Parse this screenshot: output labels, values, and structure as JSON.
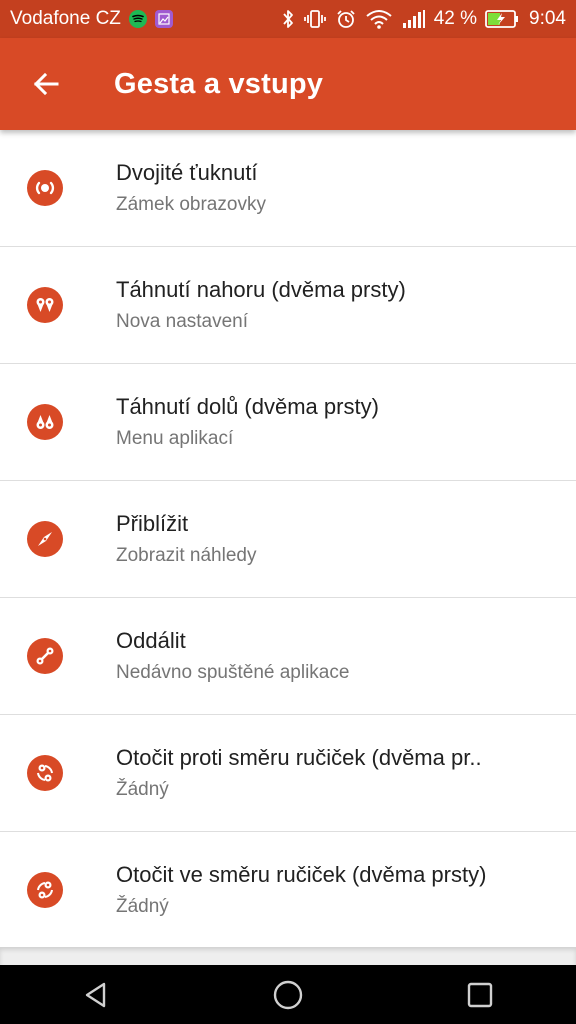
{
  "status_bar": {
    "carrier": "Vodafone CZ",
    "battery_percent": "42 %",
    "time": "9:04",
    "icons": [
      "spotify-icon",
      "gallery-icon",
      "bluetooth-icon",
      "vibrate-icon",
      "alarm-icon",
      "wifi-icon",
      "signal-icon",
      "battery-charging-icon"
    ]
  },
  "app_bar": {
    "title": "Gesta a vstupy",
    "back_icon": "arrow-left-icon"
  },
  "colors": {
    "status_bar": "#c4401f",
    "app_bar": "#d84a26",
    "accent": "#d84a26",
    "title_text": "#212121",
    "subtitle_text": "#757575"
  },
  "gestures": [
    {
      "title": "Dvojité ťuknutí",
      "subtitle": "Zámek obrazovky",
      "icon": "double-tap-icon"
    },
    {
      "title": "Táhnutí nahoru (dvěma prsty)",
      "subtitle": "Nova nastavení",
      "icon": "two-finger-swipe-up-icon"
    },
    {
      "title": "Táhnutí dolů (dvěma prsty)",
      "subtitle": "Menu aplikací",
      "icon": "two-finger-swipe-down-icon"
    },
    {
      "title": "Přiblížit",
      "subtitle": "Zobrazit náhledy",
      "icon": "pinch-out-icon"
    },
    {
      "title": "Oddálit",
      "subtitle": "Nedávno spuštěné aplikace",
      "icon": "pinch-in-icon"
    },
    {
      "title": "Otočit proti směru ručiček (dvěma pr..",
      "subtitle": "Žádný",
      "icon": "rotate-counterclockwise-icon"
    },
    {
      "title": "Otočit ve směru ručiček (dvěma prsty)",
      "subtitle": "Žádný",
      "icon": "rotate-clockwise-icon"
    }
  ],
  "nav_bar": {
    "buttons": [
      "back-triangle-icon",
      "home-circle-icon",
      "recents-square-icon"
    ]
  }
}
